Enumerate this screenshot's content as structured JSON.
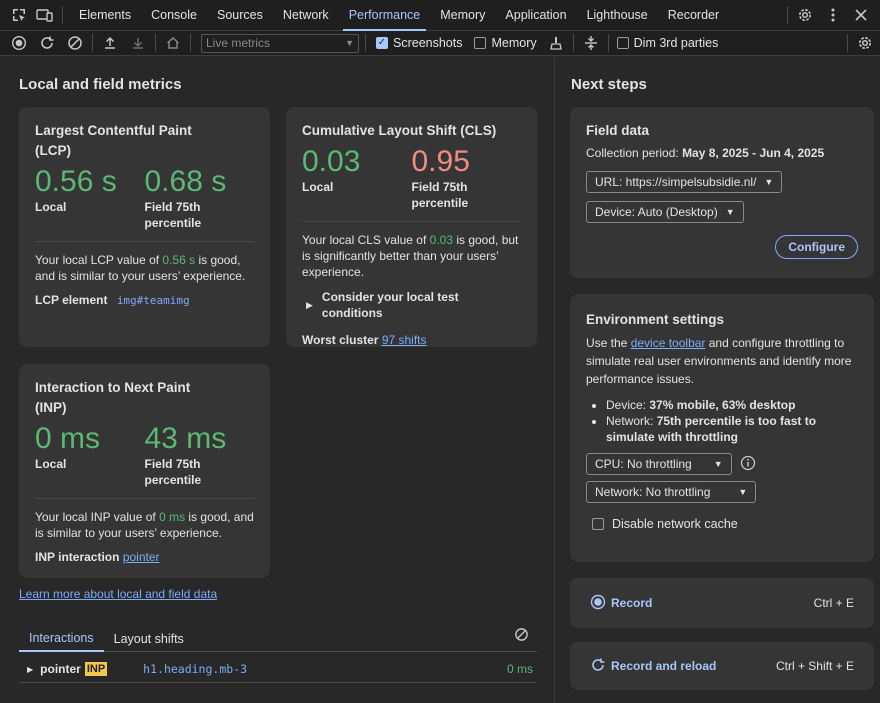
{
  "tabs": [
    "Elements",
    "Console",
    "Sources",
    "Network",
    "Performance",
    "Memory",
    "Application",
    "Lighthouse",
    "Recorder"
  ],
  "active_tab": "Performance",
  "toolbar": {
    "select_placeholder": "Live metrics",
    "screenshots_label": "Screenshots",
    "memory_label": "Memory",
    "dim_label": "Dim 3rd parties"
  },
  "left": {
    "title": "Local and field metrics",
    "lcp": {
      "title": "Largest Contentful Paint (LCP)",
      "local_value": "0.56 s",
      "local_label": "Local",
      "field_value": "0.68 s",
      "field_label": "Field 75th percentile",
      "desc_prefix": "Your local LCP value of ",
      "desc_value": "0.56 s",
      "desc_suffix": " is good, and is similar to your users’ experience.",
      "element_label": "LCP element",
      "element_value": "img#teamimg"
    },
    "cls": {
      "title": "Cumulative Layout Shift (CLS)",
      "local_value": "0.03",
      "local_label": "Local",
      "field_value": "0.95",
      "field_label": "Field 75th percentile",
      "desc_prefix": "Your local CLS value of ",
      "desc_value": "0.03",
      "desc_suffix": " is good, but is significantly better than your users’ experience.",
      "consider": "Consider your local test conditions",
      "worst_label": "Worst cluster",
      "worst_value": "97 shifts"
    },
    "inp": {
      "title": "Interaction to Next Paint (INP)",
      "local_value": "0 ms",
      "local_label": "Local",
      "field_value": "43 ms",
      "field_label": "Field 75th percentile",
      "desc_prefix": "Your local INP value of ",
      "desc_value": "0 ms",
      "desc_suffix": " is good, and is similar to your users’ experience.",
      "interaction_label": "INP interaction",
      "interaction_value": "pointer"
    },
    "learn_more": "Learn more about local and field data",
    "subtabs": [
      "Interactions",
      "Layout shifts"
    ],
    "row": {
      "type": "pointer",
      "badge": "INP",
      "selector": "h1.heading.mb-3",
      "duration": "0 ms"
    }
  },
  "right": {
    "title": "Next steps",
    "field": {
      "title": "Field data",
      "period_label": "Collection period: ",
      "period_value": "May 8, 2025 - Jun 4, 2025",
      "url": "URL: https://simpelsubsidie.nl/",
      "device": "Device: Auto (Desktop)",
      "configure": "Configure"
    },
    "env": {
      "title": "Environment settings",
      "desc_prefix": "Use the ",
      "desc_link": "device toolbar",
      "desc_suffix": " and configure throttling to simulate real user environments and identify more performance issues.",
      "bullet1_label": "Device: ",
      "bullet1_value": "37% mobile, 63% desktop",
      "bullet2_label": "Network: ",
      "bullet2_value": "75th percentile is too fast to simulate with throttling",
      "cpu": "CPU: No throttling",
      "network": "Network: No throttling",
      "disable_cache": "Disable network cache"
    },
    "record": {
      "label": "Record",
      "shortcut": "Ctrl + E"
    },
    "reload": {
      "label": "Record and reload",
      "shortcut": "Ctrl + Shift + E"
    }
  }
}
